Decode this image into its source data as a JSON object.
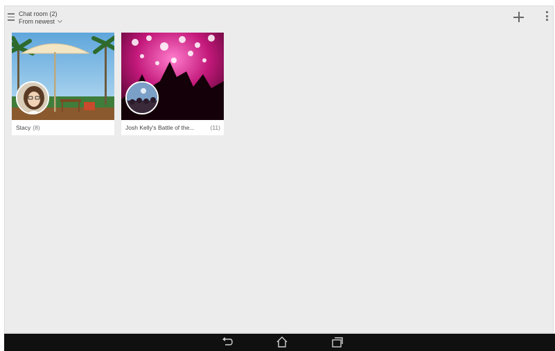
{
  "header": {
    "title": "Chat room (2)",
    "sort_label": "From newest"
  },
  "icons": {
    "menu": "menu-icon",
    "add": "plus-icon",
    "more": "more-vert-icon",
    "back": "back-icon",
    "home": "home-icon",
    "recents": "recents-icon"
  },
  "rooms": [
    {
      "name": "Stacy",
      "count": "(8)"
    },
    {
      "name": "Josh Kelly's Battle of the...",
      "count": "(11)"
    }
  ],
  "colors": {
    "background": "#ececec",
    "navbar": "#101010",
    "concert_pink": "#c2187a"
  }
}
